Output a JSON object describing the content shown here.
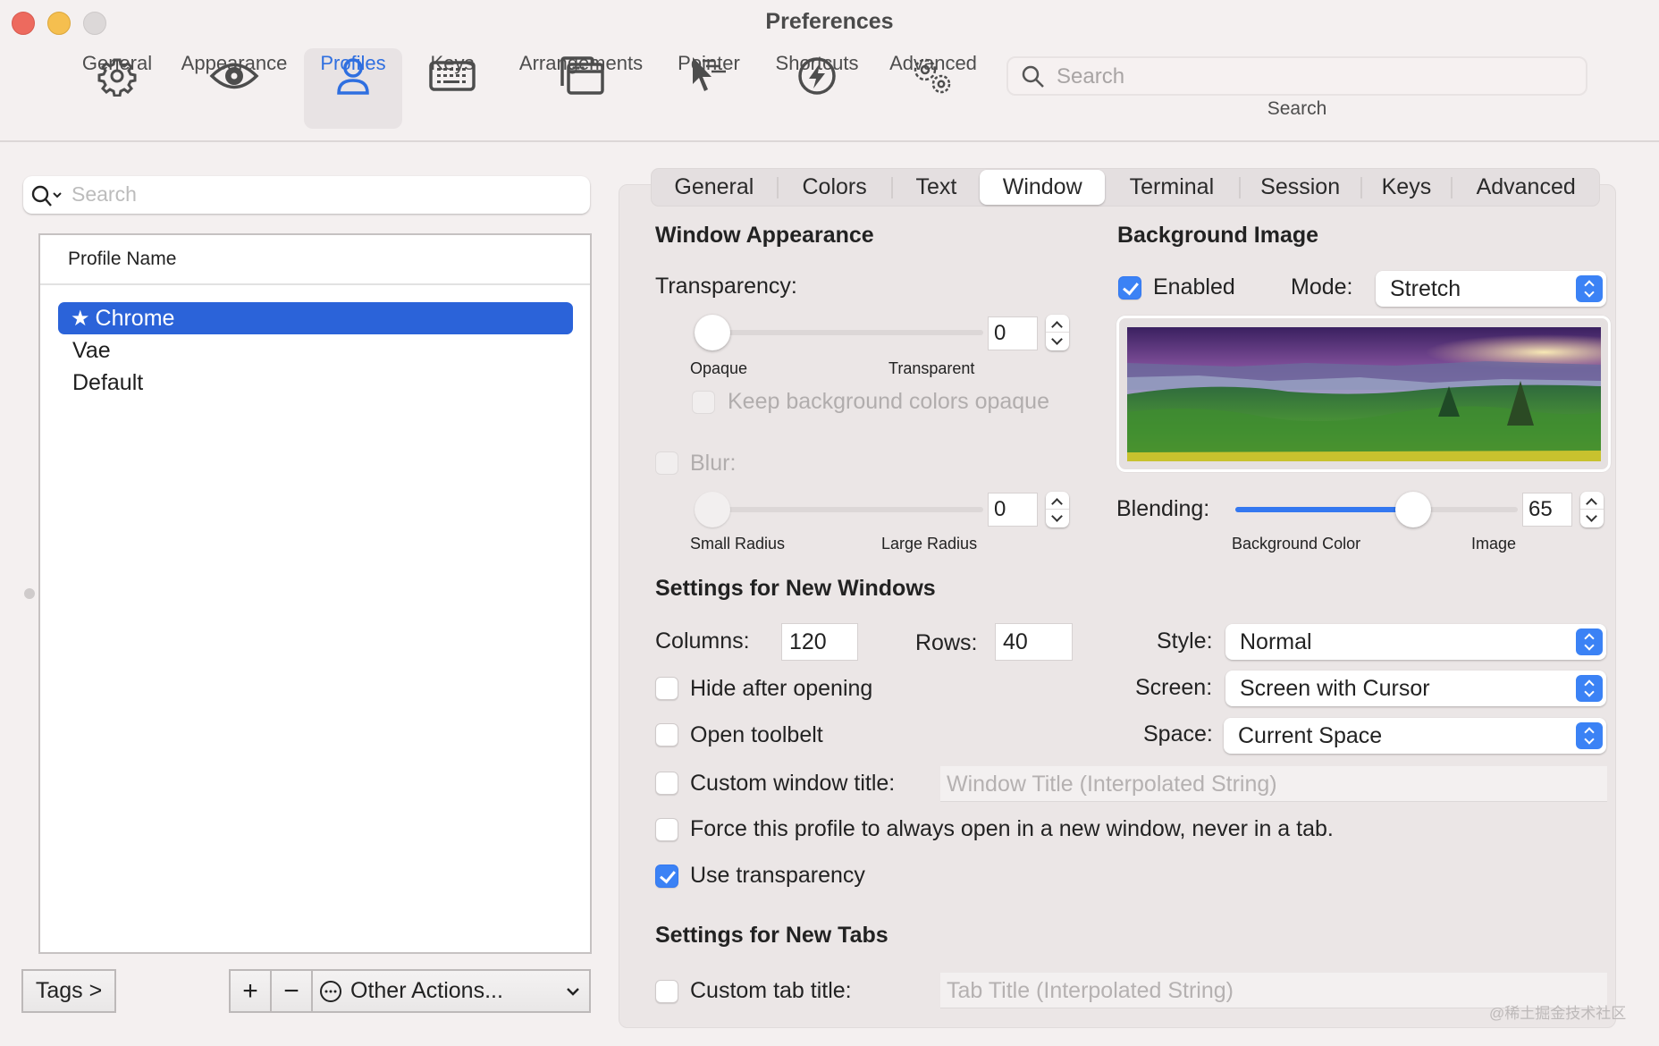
{
  "window": {
    "title": "Preferences",
    "traffic_lights": {
      "close": "#ed6a5e",
      "minimize": "#f5bf4f",
      "zoom": "#dcd8d8"
    }
  },
  "toolbar": {
    "items": [
      {
        "label": "General",
        "icon": "gear-icon"
      },
      {
        "label": "Appearance",
        "icon": "eye-icon"
      },
      {
        "label": "Profiles",
        "icon": "person-icon",
        "active": true
      },
      {
        "label": "Keys",
        "icon": "keyboard-icon"
      },
      {
        "label": "Arrangements",
        "icon": "windows-icon"
      },
      {
        "label": "Pointer",
        "icon": "pointer-icon"
      },
      {
        "label": "Shortcuts",
        "icon": "bolt-icon"
      },
      {
        "label": "Advanced",
        "icon": "gears-icon"
      }
    ],
    "search": {
      "placeholder": "Search",
      "label": "Search"
    }
  },
  "sidebar": {
    "search_placeholder": "Search",
    "list_header": "Profile Name",
    "profiles": [
      {
        "name": "Chrome",
        "selected": true,
        "default_star": true
      },
      {
        "name": "Vae"
      },
      {
        "name": "Default"
      }
    ],
    "tags_button": "Tags >",
    "add_button": "+",
    "remove_button": "−",
    "other_actions": "Other Actions..."
  },
  "tabs": {
    "items": [
      "General",
      "Colors",
      "Text",
      "Window",
      "Terminal",
      "Session",
      "Keys",
      "Advanced"
    ],
    "active": "Window"
  },
  "window_appearance": {
    "heading": "Window Appearance",
    "transparency_label": "Transparency:",
    "transparency_value": "0",
    "transparency_min_label": "Opaque",
    "transparency_max_label": "Transparent",
    "transparency_fraction": 0,
    "keep_bg_opaque_label": "Keep background colors opaque",
    "keep_bg_opaque_checked": false,
    "blur_label": "Blur:",
    "blur_checked": false,
    "blur_value": "0",
    "blur_min_label": "Small Radius",
    "blur_max_label": "Large Radius",
    "blur_fraction": 0
  },
  "background_image": {
    "heading": "Background Image",
    "enabled_label": "Enabled",
    "enabled_checked": true,
    "mode_label": "Mode:",
    "mode_value": "Stretch",
    "blending_label": "Blending:",
    "blending_value": "65",
    "blending_fraction": 0.65,
    "blending_min_label": "Background Color",
    "blending_max_label": "Image"
  },
  "new_windows": {
    "heading": "Settings for New Windows",
    "columns_label": "Columns:",
    "columns_value": "120",
    "rows_label": "Rows:",
    "rows_value": "40",
    "style_label": "Style:",
    "style_value": "Normal",
    "screen_label": "Screen:",
    "screen_value": "Screen with Cursor",
    "space_label": "Space:",
    "space_value": "Current Space",
    "hide_after_opening": "Hide after opening",
    "open_toolbelt": "Open toolbelt",
    "custom_window_title": "Custom window title:",
    "window_title_placeholder": "Window Title (Interpolated String)",
    "force_new_window": "Force this profile to always open in a new window, never in a tab.",
    "use_transparency": "Use transparency",
    "use_transparency_checked": true
  },
  "new_tabs": {
    "heading": "Settings for New Tabs",
    "custom_tab_title": "Custom tab title:",
    "tab_title_placeholder": "Tab Title (Interpolated String)"
  },
  "watermark": "@稀土掘金技术社区",
  "colors": {
    "accent": "#3478f0",
    "selection": "#2b63d9"
  }
}
